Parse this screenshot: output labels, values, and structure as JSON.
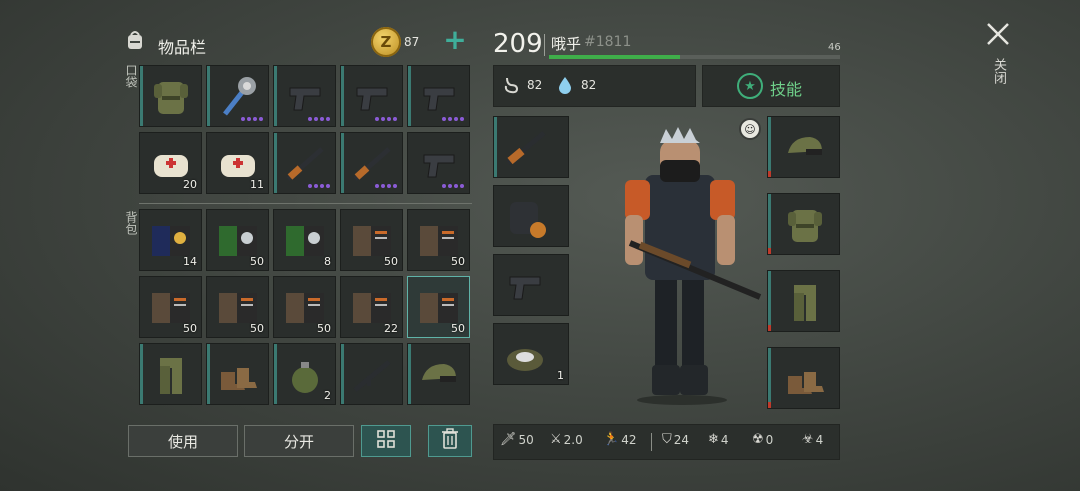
{
  "header": {
    "title": "物品栏",
    "coins": "87",
    "close_label": "关闭"
  },
  "sections": {
    "pockets": "口袋",
    "backpack": "背包"
  },
  "player": {
    "level": "209",
    "name": "哦乎",
    "id": "#1811",
    "xp_value": "46",
    "xp_fraction": 0.45
  },
  "vitals": {
    "food": "82",
    "water": "82"
  },
  "skills_label": "技能",
  "buttons": {
    "use": "使用",
    "split": "分开"
  },
  "pockets": [
    {
      "icon": "vest-icon",
      "count": "",
      "dots": 0
    },
    {
      "icon": "spiked-mace-icon",
      "count": "",
      "dots": 4
    },
    {
      "icon": "pistol-icon",
      "count": "",
      "dots": 4
    },
    {
      "icon": "pistol-icon",
      "count": "",
      "dots": 4
    },
    {
      "icon": "pistol-icon",
      "count": "",
      "dots": 4
    },
    {
      "icon": "bandage-icon",
      "count": "20",
      "dots": 0
    },
    {
      "icon": "bandage-icon",
      "count": "11",
      "dots": 0
    },
    {
      "icon": "shotgun-icon",
      "count": "",
      "dots": 4
    },
    {
      "icon": "shotgun-icon",
      "count": "",
      "dots": 4
    },
    {
      "icon": "pistol-icon",
      "count": "",
      "dots": 4
    }
  ],
  "backpack": [
    {
      "icon": "blue-book-icon",
      "count": "14"
    },
    {
      "icon": "green-book-icon",
      "count": "50"
    },
    {
      "icon": "green-book-icon",
      "count": "8"
    },
    {
      "icon": "recipe-book-icon",
      "count": "50"
    },
    {
      "icon": "recipe-book-icon",
      "count": "50"
    },
    {
      "icon": "recipe-book-icon",
      "count": "50"
    },
    {
      "icon": "recipe-book-icon",
      "count": "50"
    },
    {
      "icon": "recipe-book-icon",
      "count": "50"
    },
    {
      "icon": "recipe-book-icon",
      "count": "22"
    },
    {
      "icon": "recipe-book-icon",
      "count": "50"
    },
    {
      "icon": "camo-pants-icon",
      "count": ""
    },
    {
      "icon": "boots-icon",
      "count": ""
    },
    {
      "icon": "grenade-icon",
      "count": "2"
    },
    {
      "icon": "assault-rifle-icon",
      "count": ""
    },
    {
      "icon": "camo-cap-icon",
      "count": ""
    }
  ],
  "equipped_weapons": [
    {
      "icon": "rifle-icon",
      "count": ""
    },
    {
      "icon": "backpack-icon",
      "count": ""
    },
    {
      "icon": "pistol-icon",
      "count": ""
    },
    {
      "icon": "landmine-icon",
      "count": "1"
    }
  ],
  "equipped_armor": [
    {
      "icon": "camo-cap-icon"
    },
    {
      "icon": "vest-icon"
    },
    {
      "icon": "camo-pants-icon"
    },
    {
      "icon": "boots-icon"
    }
  ],
  "stats": [
    {
      "icon": "melee-icon",
      "value": "50"
    },
    {
      "icon": "attack-speed-icon",
      "value": "2.0"
    },
    {
      "icon": "run-icon",
      "value": "42"
    },
    {
      "icon": "armor-icon",
      "value": "24"
    },
    {
      "icon": "cold-icon",
      "value": "4"
    },
    {
      "icon": "radiation-icon",
      "value": "0"
    },
    {
      "icon": "bio-icon",
      "value": "4"
    }
  ],
  "colors": {
    "accent": "#3fae7a",
    "teal": "#4f9a90",
    "rarity_purple": "#8b5bd6",
    "durability_red": "#c03a2b"
  }
}
